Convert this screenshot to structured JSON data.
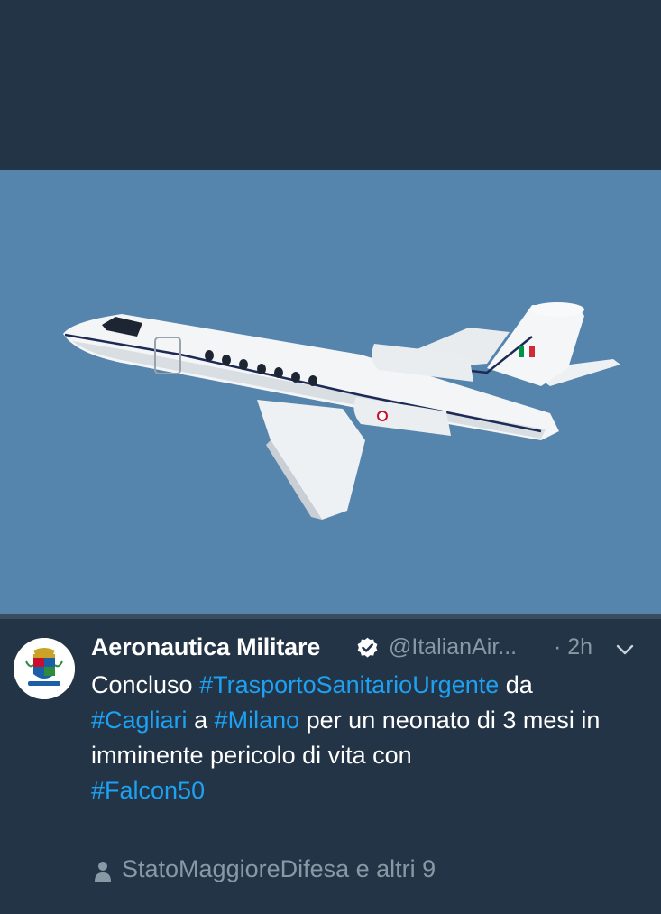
{
  "tweet": {
    "author_name": "Aeronautica Militare",
    "handle": "@ItalianAir...",
    "separator": " · ",
    "time": "2h",
    "body": {
      "t1": "Concluso ",
      "h1": "#TrasportoSanitarioUrgente",
      "t2": " da",
      "h2": "#Cagliari",
      "t3": " a ",
      "h3": "#Milano",
      "t4": " per un neonato di 3 mesi in imminente pericolo di vita con",
      "h4": "#Falcon50"
    },
    "retweeted_by": "StatoMaggioreDifesa e altri 9"
  },
  "media": {
    "description": "photo of Italian Air Force Falcon 50 jet in blue sky"
  },
  "colors": {
    "background": "#243447",
    "sky": "#5584ad",
    "hashtag": "#1da1f2",
    "secondary_text": "#8899a6"
  },
  "icons": {
    "verified": "verified-badge-icon",
    "menu": "chevron-down-icon",
    "person": "person-icon"
  }
}
